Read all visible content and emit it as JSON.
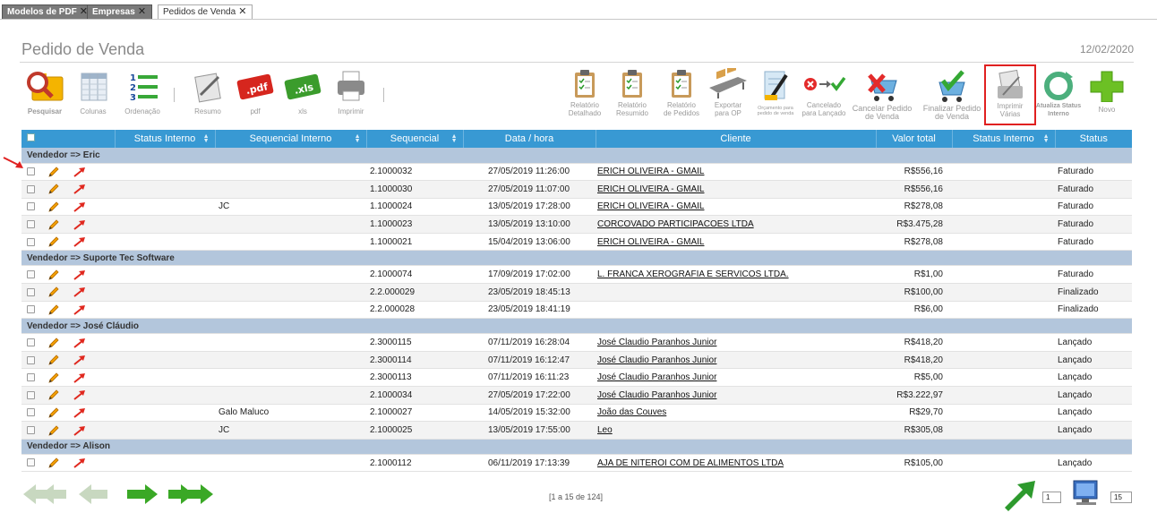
{
  "tabs": [
    {
      "label": "Modelos de PDF",
      "close": "✕"
    },
    {
      "label": "Empresas",
      "close": "✕"
    },
    {
      "label": "Pedidos de Venda",
      "close": "✕"
    }
  ],
  "header": {
    "title": "Pedido de Venda",
    "date": "12/02/2020"
  },
  "toolbar": {
    "pesquisar": "Pesquisar",
    "colunas": "Colunas",
    "ordenacao": "Ordenação",
    "resumo": "Resumo",
    "pdf": "pdf",
    "xls": "xls",
    "imprimir": "Imprimir",
    "rel_detalhado_1": "Relatório",
    "rel_detalhado_2": "Detalhado",
    "rel_resumido_1": "Relatório",
    "rel_resumido_2": "Resumido",
    "rel_pedidos_1": "Relatório",
    "rel_pedidos_2": "de Pedidos",
    "exportar_1": "Exportar",
    "exportar_2": "para OP",
    "orcamento": "Orçamento para pedido de venda",
    "cancelado_1": "Cancelado",
    "cancelado_2": "para Lançado",
    "cancelar_1": "Cancelar Pedido",
    "cancelar_2": "de Venda",
    "finalizar_1": "Finalizar Pedido",
    "finalizar_2": "de Venda",
    "imprimir_varias_1": "Imprimir",
    "imprimir_varias_2": "Várias",
    "atualiza_1": "Atualiza Status",
    "atualiza_2": "Interno",
    "novo": "Novo",
    "pdf_text": ".pdf",
    "xls_text": ".xls"
  },
  "columns": [
    "Status Interno",
    "Sequencial Interno",
    "Sequencial",
    "Data / hora",
    "Cliente",
    "Valor total",
    "Status Interno",
    "Status"
  ],
  "groups": [
    {
      "label": "Vendedor => Eric",
      "rows": [
        {
          "si": "",
          "seq": "2.1000032",
          "dt": "27/05/2019 11:26:00",
          "cli": "ERICH OLIVEIRA - GMAIL",
          "val": "R$556,16",
          "st": "Faturado"
        },
        {
          "si": "",
          "seq": "1.1000030",
          "dt": "27/05/2019 11:07:00",
          "cli": "ERICH OLIVEIRA - GMAIL",
          "val": "R$556,16",
          "st": "Faturado"
        },
        {
          "si": "JC",
          "seq": "1.1000024",
          "dt": "13/05/2019 17:28:00",
          "cli": "ERICH OLIVEIRA - GMAIL",
          "val": "R$278,08",
          "st": "Faturado"
        },
        {
          "si": "",
          "seq": "1.1000023",
          "dt": "13/05/2019 13:10:00",
          "cli": "CORCOVADO PARTICIPACOES LTDA",
          "val": "R$3.475,28",
          "st": "Faturado"
        },
        {
          "si": "",
          "seq": "1.1000021",
          "dt": "15/04/2019 13:06:00",
          "cli": "ERICH OLIVEIRA - GMAIL",
          "val": "R$278,08",
          "st": "Faturado"
        }
      ]
    },
    {
      "label": "Vendedor => Suporte Tec Software",
      "rows": [
        {
          "si": "",
          "seq": "2.1000074",
          "dt": "17/09/2019 17:02:00",
          "cli": "L. FRANCA XEROGRAFIA E SERVICOS LTDA.",
          "val": "R$1,00",
          "st": "Faturado"
        },
        {
          "si": "",
          "seq": "2.2.000029",
          "dt": "23/05/2019 18:45:13",
          "cli": "",
          "val": "R$100,00",
          "st": "Finalizado"
        },
        {
          "si": "",
          "seq": "2.2.000028",
          "dt": "23/05/2019 18:41:19",
          "cli": "",
          "val": "R$6,00",
          "st": "Finalizado"
        }
      ]
    },
    {
      "label": "Vendedor => José Cláudio",
      "rows": [
        {
          "si": "",
          "seq": "2.3000115",
          "dt": "07/11/2019 16:28:04",
          "cli": "José Claudio Paranhos Junior",
          "val": "R$418,20",
          "st": "Lançado"
        },
        {
          "si": "",
          "seq": "2.3000114",
          "dt": "07/11/2019 16:12:47",
          "cli": "José Claudio Paranhos Junior",
          "val": "R$418,20",
          "st": "Lançado"
        },
        {
          "si": "",
          "seq": "2.3000113",
          "dt": "07/11/2019 16:11:23",
          "cli": "José Claudio Paranhos Junior",
          "val": "R$5,00",
          "st": "Lançado"
        },
        {
          "si": "",
          "seq": "2.1000034",
          "dt": "27/05/2019 17:22:00",
          "cli": "José Claudio Paranhos Junior",
          "val": "R$3.222,97",
          "st": "Lançado"
        },
        {
          "si": "Galo Maluco",
          "seq": "2.1000027",
          "dt": "14/05/2019 15:32:00",
          "cli": "João das Couves",
          "val": "R$29,70",
          "st": "Lançado"
        },
        {
          "si": "JC",
          "seq": "2.1000025",
          "dt": "13/05/2019 17:55:00",
          "cli": "Leo",
          "val": "R$305,08",
          "st": "Lançado"
        }
      ]
    },
    {
      "label": "Vendedor => Alison",
      "rows": [
        {
          "si": "",
          "seq": "2.1000112",
          "dt": "06/11/2019 17:13:39",
          "cli": "AJA DE NITEROI COM DE ALIMENTOS LTDA",
          "val": "R$105,00",
          "st": "Lançado"
        }
      ]
    }
  ],
  "footer": {
    "pager": "[1 a 15 de 124]",
    "page": "1",
    "page_size": "15"
  },
  "colors": {
    "accent": "#3899d3",
    "group": "#b3c6dc",
    "highlight": "#e02020"
  }
}
